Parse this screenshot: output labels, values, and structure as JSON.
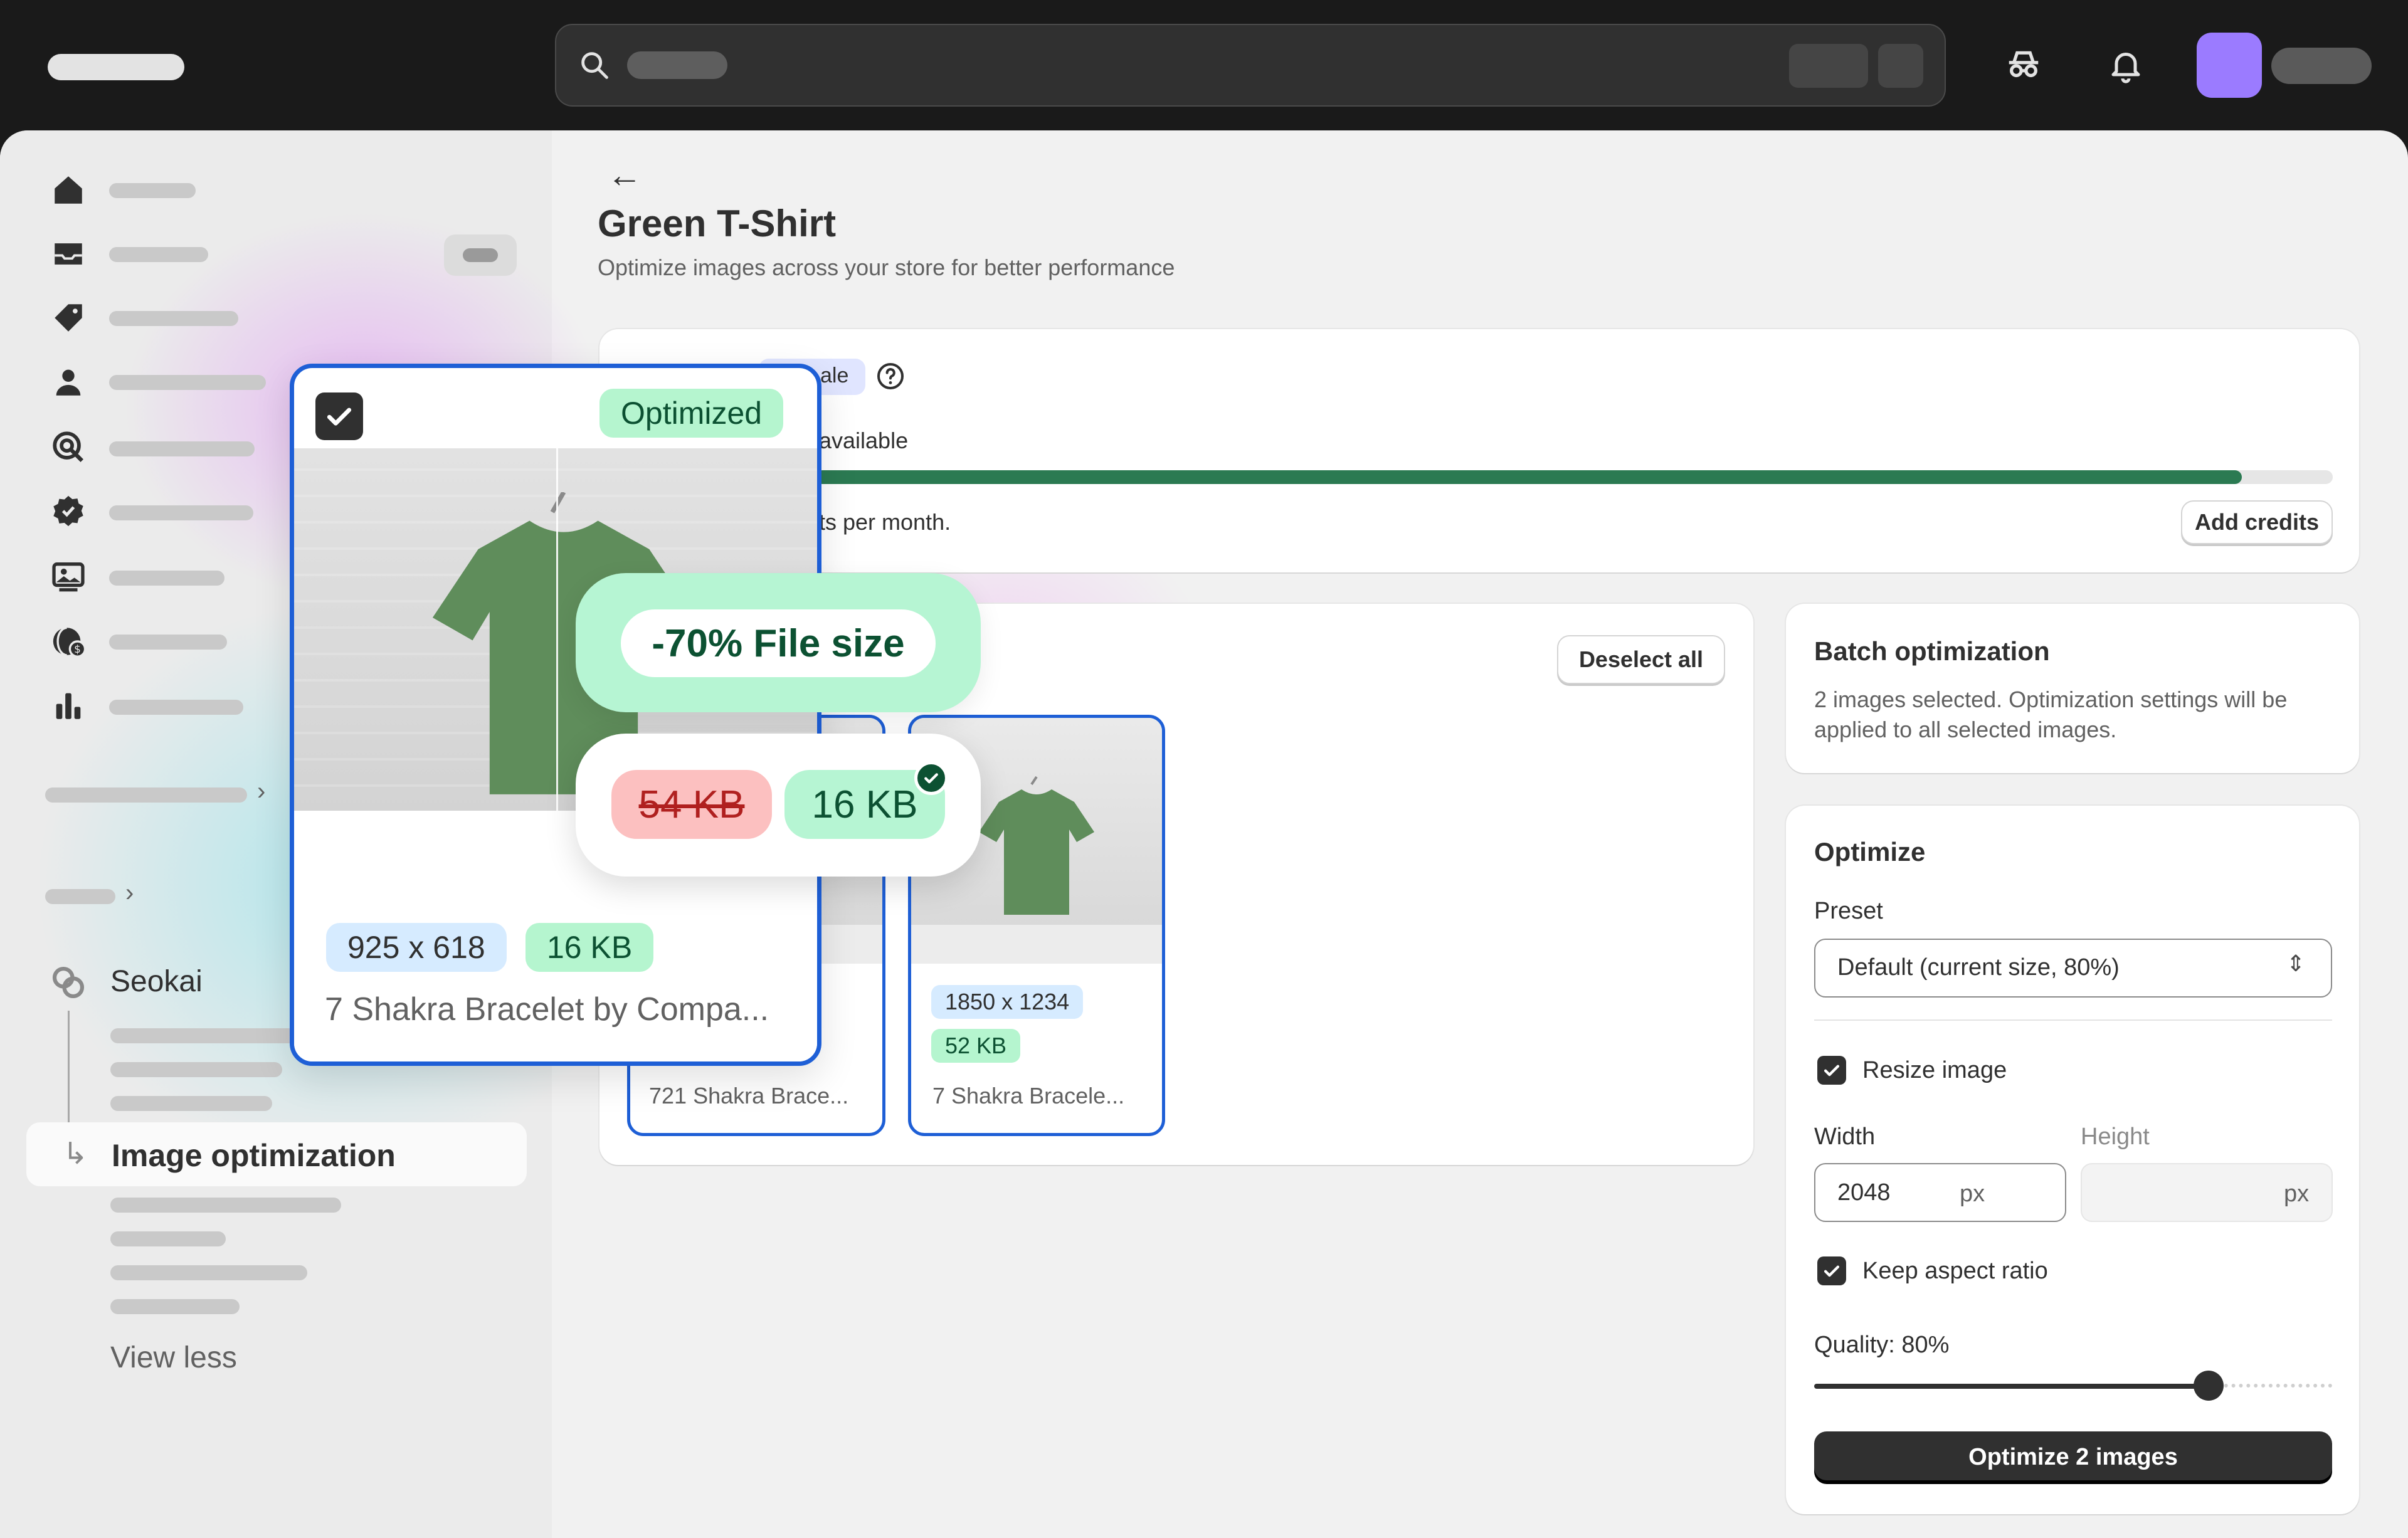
{
  "page": {
    "title": "Green T-Shirt",
    "subtitle": "Optimize images across your store for better performance"
  },
  "credits": {
    "badge_fragment": "ale",
    "available_fragment": "available",
    "month_fragment": "ts per month.",
    "progress_fraction": 0.94,
    "add_credits_label": "Add credits"
  },
  "images": {
    "deselect_label": "Deselect all",
    "items": [
      {
        "caption": "721 Shakra Brace..."
      },
      {
        "dimensions": "1850 x 1234",
        "size": "52 KB",
        "caption": "7 Shakra Bracele..."
      }
    ]
  },
  "batch": {
    "title": "Batch optimization",
    "description": "2 images selected. Optimization settings will be applied to all selected images."
  },
  "optimize": {
    "title": "Optimize",
    "preset_label": "Preset",
    "preset_value": "Default (current size, 80%)",
    "resize_label": "Resize image",
    "width_label": "Width",
    "height_label": "Height",
    "width_value": "2048",
    "unit": "px",
    "keep_aspect_label": "Keep aspect ratio",
    "quality_label": "Quality: 80%",
    "quality_value": 80,
    "submit_label": "Optimize 2 images"
  },
  "sidebar": {
    "app_name": "Seokai",
    "active_item": "Image optimization",
    "view_less": "View less"
  },
  "overlay": {
    "status": "Optimized",
    "dimensions": "925 x 618",
    "size": "16 KB",
    "caption": "7 Shakra Bracelet by Compa...",
    "reduction": "-70% File size",
    "old_size": "54 KB",
    "new_size": "16 KB"
  },
  "colors": {
    "accent_blue": "#1e5fd6",
    "success_green": "#2b7a52",
    "avatar": "#9b7bff"
  }
}
